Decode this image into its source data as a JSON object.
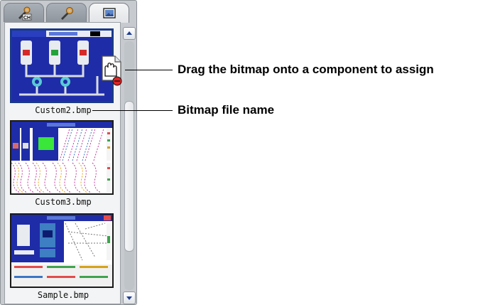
{
  "tabs": [
    {
      "icon": "channel-wrench-icon",
      "label": "CH"
    },
    {
      "icon": "wrench-icon"
    },
    {
      "icon": "image-icon"
    }
  ],
  "files": [
    {
      "name": "Custom2.bmp"
    },
    {
      "name": "Custom3.bmp"
    },
    {
      "name": "Sample.bmp"
    }
  ],
  "callouts": {
    "drag": "Drag the bitmap onto a component to assign",
    "filename": "Bitmap file name"
  },
  "colors": {
    "selection": "#1a3a88",
    "thumb_blue": "#1e2ca8"
  }
}
